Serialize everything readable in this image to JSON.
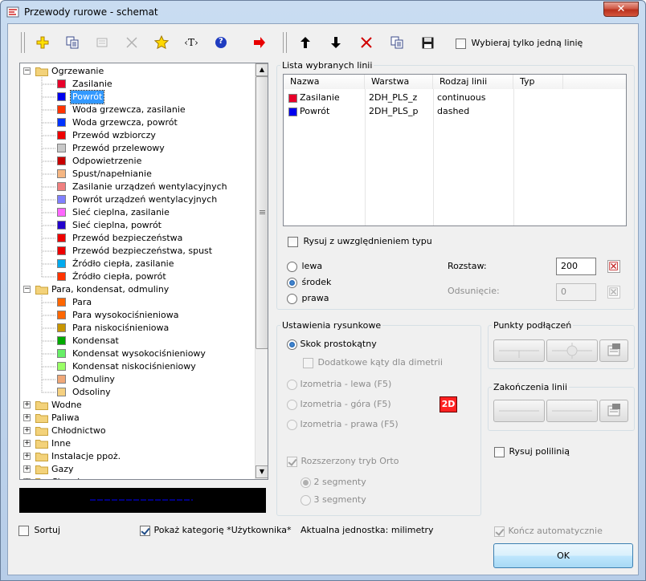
{
  "window": {
    "title": "Przewody rurowe - schemat",
    "close_label": "✕"
  },
  "toolbar": {
    "only_one_line_label": "Wybieraj tylko jedną linię",
    "only_one_line_checked": false,
    "text_tool_label": "‹T›",
    "help_label": "?"
  },
  "tree": {
    "items": [
      {
        "label": "Ogrzewanie",
        "type": "folder",
        "expanded": true
      },
      {
        "label": "Zasilanie",
        "color": "#e8002a"
      },
      {
        "label": "Powrót",
        "color": "#0000ee",
        "selected": true
      },
      {
        "label": "Woda grzewcza, zasilanie",
        "color": "#ff3300"
      },
      {
        "label": "Woda grzewcza, powrót",
        "color": "#0033ff"
      },
      {
        "label": "Przewód wzbiorczy",
        "color": "#ee0000"
      },
      {
        "label": "Przewód przelewowy",
        "color": "#c8c8c8"
      },
      {
        "label": "Odpowietrzenie",
        "color": "#c80000"
      },
      {
        "label": "Spust/napełnianie",
        "color": "#f5b682"
      },
      {
        "label": "Zasilanie urządzeń wentylacyjnych",
        "color": "#f08080"
      },
      {
        "label": "Powrót urządzeń wentylacyjnych",
        "color": "#8080ff"
      },
      {
        "label": "Sieć cieplna, zasilanie",
        "color": "#ff66ff"
      },
      {
        "label": "Sieć cieplna, powrót",
        "color": "#2200cc"
      },
      {
        "label": "Przewód bezpieczeństwa",
        "color": "#ee0000"
      },
      {
        "label": "Przewód bezpieczeństwa, spust",
        "color": "#ee0000"
      },
      {
        "label": "Źródło ciepła, zasilanie",
        "color": "#00aaee"
      },
      {
        "label": "Źródło ciepła, powrót",
        "color": "#ff3300"
      },
      {
        "label": "Para, kondensat, odmuliny",
        "type": "folder",
        "expanded": true
      },
      {
        "label": "Para",
        "color": "#ff6600"
      },
      {
        "label": "Para wysokociśnieniowa",
        "color": "#ff6600"
      },
      {
        "label": "Para niskociśnieniowa",
        "color": "#c89600"
      },
      {
        "label": "Kondensat",
        "color": "#00aa00"
      },
      {
        "label": "Kondensat wysokociśnieniowy",
        "color": "#66ee66"
      },
      {
        "label": "Kondensat niskociśnieniowy",
        "color": "#99ff66"
      },
      {
        "label": "Odmuliny",
        "color": "#f0a878"
      },
      {
        "label": "Odsoliny",
        "color": "#f5d080"
      },
      {
        "label": "Wodne",
        "type": "folder",
        "expanded": false
      },
      {
        "label": "Paliwa",
        "type": "folder",
        "expanded": false
      },
      {
        "label": "Chłodnictwo",
        "type": "folder",
        "expanded": false
      },
      {
        "label": "Inne",
        "type": "folder",
        "expanded": false
      },
      {
        "label": "Instalacje ppoż.",
        "type": "folder",
        "expanded": false
      },
      {
        "label": "Gazy",
        "type": "folder",
        "expanded": false
      },
      {
        "label": "Chemia",
        "type": "folder",
        "expanded": false
      }
    ]
  },
  "selected_lines": {
    "group_title": "Lista wybranych linii",
    "columns": [
      "Nazwa",
      "Warstwa",
      "Rodzaj linii",
      "Typ"
    ],
    "rows": [
      {
        "name": "Zasilanie",
        "color": "#e8002a",
        "layer": "2DH_PLS_z",
        "line_type": "continuous",
        "type": ""
      },
      {
        "name": "Powrót",
        "color": "#0000ee",
        "layer": "2DH_PLS_p",
        "line_type": "dashed",
        "type": ""
      }
    ],
    "draw_with_type_label": "Rysuj z uwzględnieniem typu",
    "draw_with_type_checked": false,
    "position_options": [
      "lewa",
      "środek",
      "prawa"
    ],
    "position_selected": "środek",
    "spacing_label": "Rozstaw:",
    "spacing_value": "200",
    "offset_label": "Odsunięcie:",
    "offset_value": "0"
  },
  "drawing_settings": {
    "group_title": "Ustawienia rysunkowe",
    "rect_step_label": "Skok prostokątny",
    "extra_angles_label": "Dodatkowe kąty dla dimetrii",
    "iso_left_label": "Izometria - lewa (F5)",
    "iso_top_label": "Izometria - góra (F5)",
    "iso_right_label": "Izometria - prawa (F5)",
    "mode_badge": "2D",
    "ortho_label": "Rozszerzony tryb Orto",
    "ortho_checked": true,
    "two_segments_label": "2 segmenty",
    "three_segments_label": "3 segmenty"
  },
  "connection_points": {
    "group_title": "Punkty podłączeń"
  },
  "line_endings": {
    "group_title": "Zakończenia linii"
  },
  "draw_polyline_label": "Rysuj polilinią",
  "draw_polyline_checked": false,
  "bottom": {
    "sort_label": "Sortuj",
    "sort_checked": false,
    "show_user_category_label": "Pokaż kategorię *Użytkownika*",
    "show_user_category_checked": true,
    "current_unit_label": "Aktualna jednostka: milimetry",
    "finish_auto_label": "Kończ automatycznie",
    "finish_auto_checked": true,
    "ok_label": "OK"
  },
  "colors": {
    "preview_line": "#0000ff",
    "badge_bg": "#ff2222"
  }
}
